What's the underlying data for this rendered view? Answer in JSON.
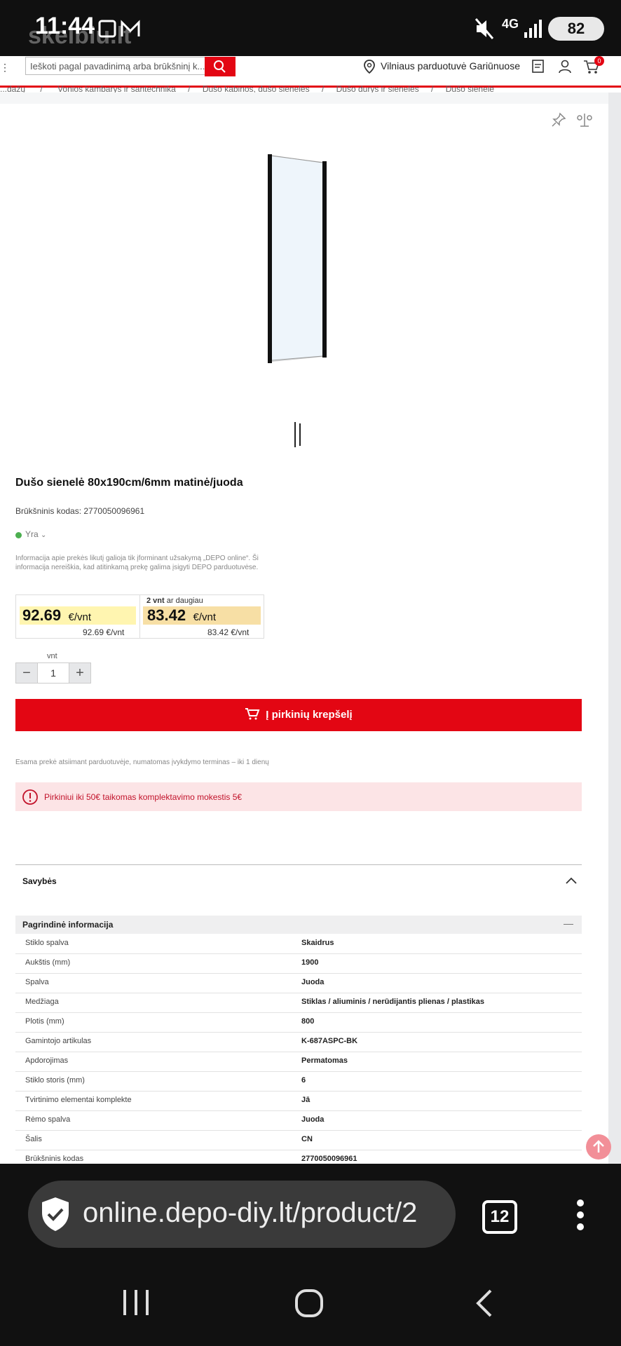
{
  "status_bar": {
    "time": "11:44",
    "network": "4G",
    "battery": "82",
    "watermark": "skelbiu.lt"
  },
  "header": {
    "search_placeholder": "Ieškoti pagal pavadinimą arba brūkšninį k...",
    "store": "Vilniaus parduotuvė Gariūnuose",
    "cart_count": "0"
  },
  "breadcrumb": [
    "...dažų",
    "Vonios kambarys ir santechnika",
    "Dušo kabinos, dušo sienelės",
    "Dušo durys ir sienelės",
    "Dušo sienelė"
  ],
  "product": {
    "title": "Dušo sienelė 80x190cm/6mm matinė/juoda",
    "barcode_label": "Brūkšninis kodas: 2770050096961",
    "availability": "Yra",
    "stock_note": "Informacija apie prekės likutį galioja tik įforminant užsakymą „DEPO online“. Ši informacija nereiškia, kad atitinkamą prekę galima įsigyti DEPO parduotuvėse."
  },
  "pricing": {
    "tier1": {
      "price": "92.69",
      "unit": "€/vnt",
      "sub_price": "92.69",
      "sub_unit": "€/vnt"
    },
    "tier2": {
      "qty_label_bold": "2 vnt",
      "qty_label_rest": "ar daugiau",
      "price": "83.42",
      "unit": "€/vnt",
      "sub_price": "83.42",
      "sub_unit": "€/vnt"
    }
  },
  "quantity": {
    "label": "vnt",
    "value": "1"
  },
  "cart_button": "Į pirkinių krepšelį",
  "pickup_note": "Esama prekė atsiimant parduotuvėje, numatomas įvykdymo terminas – iki 1 dienų",
  "alert": "Pirkiniui iki 50€ taikomas komplektavimo mokestis 5€",
  "properties": {
    "title": "Savybės",
    "subsection": "Pagrindinė informacija",
    "rows": [
      {
        "label": "Stiklo spalva",
        "value": "Skaidrus"
      },
      {
        "label": "Aukštis (mm)",
        "value": "1900"
      },
      {
        "label": "Spalva",
        "value": "Juoda"
      },
      {
        "label": "Medžiaga",
        "value": "Stiklas / aliuminis / nerūdijantis plienas / plastikas"
      },
      {
        "label": "Plotis (mm)",
        "value": "800"
      },
      {
        "label": "Gamintojo artikulas",
        "value": "K-687ASPC-BK"
      },
      {
        "label": "Apdorojimas",
        "value": "Permatomas"
      },
      {
        "label": "Stiklo storis (mm)",
        "value": "6"
      },
      {
        "label": "Tvirtinimo elementai komplekte",
        "value": "Jā"
      },
      {
        "label": "Rėmo spalva",
        "value": "Juoda"
      },
      {
        "label": "Šalis",
        "value": "CN"
      },
      {
        "label": "Brūkšninis kodas",
        "value": "2770050096961"
      }
    ]
  },
  "browser": {
    "url": "online.depo-diy.lt/product/2",
    "tab_count": "12"
  },
  "colors": {
    "accent": "#e30613",
    "alert_bg": "#fce4e6",
    "price_highlight": "#fff5b0"
  }
}
